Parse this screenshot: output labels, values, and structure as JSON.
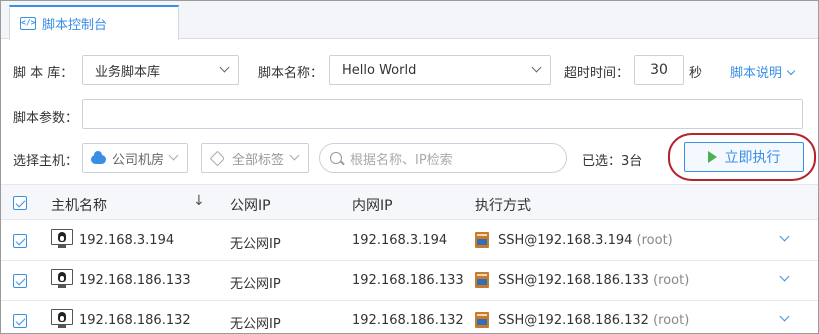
{
  "tab": {
    "label": "脚本控制台"
  },
  "form": {
    "library_label": "脚 本 库：",
    "library_value": "业务脚本库",
    "script_name_label": "脚本名称：",
    "script_name_value": "Hello World",
    "timeout_label": "超时时间：",
    "timeout_value": "30",
    "timeout_unit": "秒",
    "doc_link": "脚本说明",
    "params_label": "脚本参数："
  },
  "host_select": {
    "label": "选择主机：",
    "region": "公司机房",
    "tags": "全部标签",
    "search_placeholder": "根据名称、IP检索",
    "selected_text": "已选：3台",
    "run_button": "立即执行"
  },
  "table": {
    "columns": [
      "主机名称",
      "公网IP",
      "内网IP",
      "执行方式"
    ],
    "sort_indicator": "↓",
    "rows": [
      {
        "name": "192.168.3.194",
        "public_ip": "无公网IP",
        "private_ip": "192.168.3.194",
        "method": "SSH@192.168.3.194",
        "user": "(root)"
      },
      {
        "name": "192.168.186.133",
        "public_ip": "无公网IP",
        "private_ip": "192.168.186.133",
        "method": "SSH@192.168.186.133",
        "user": "(root)"
      },
      {
        "name": "192.168.186.132",
        "public_ip": "无公网IP",
        "private_ip": "192.168.186.132",
        "method": "SSH@192.168.186.132",
        "user": "(root)"
      }
    ]
  },
  "colors": {
    "accent": "#3a8ee6",
    "highlight_oval": "#b3242c",
    "run_icon": "#4caf50"
  }
}
